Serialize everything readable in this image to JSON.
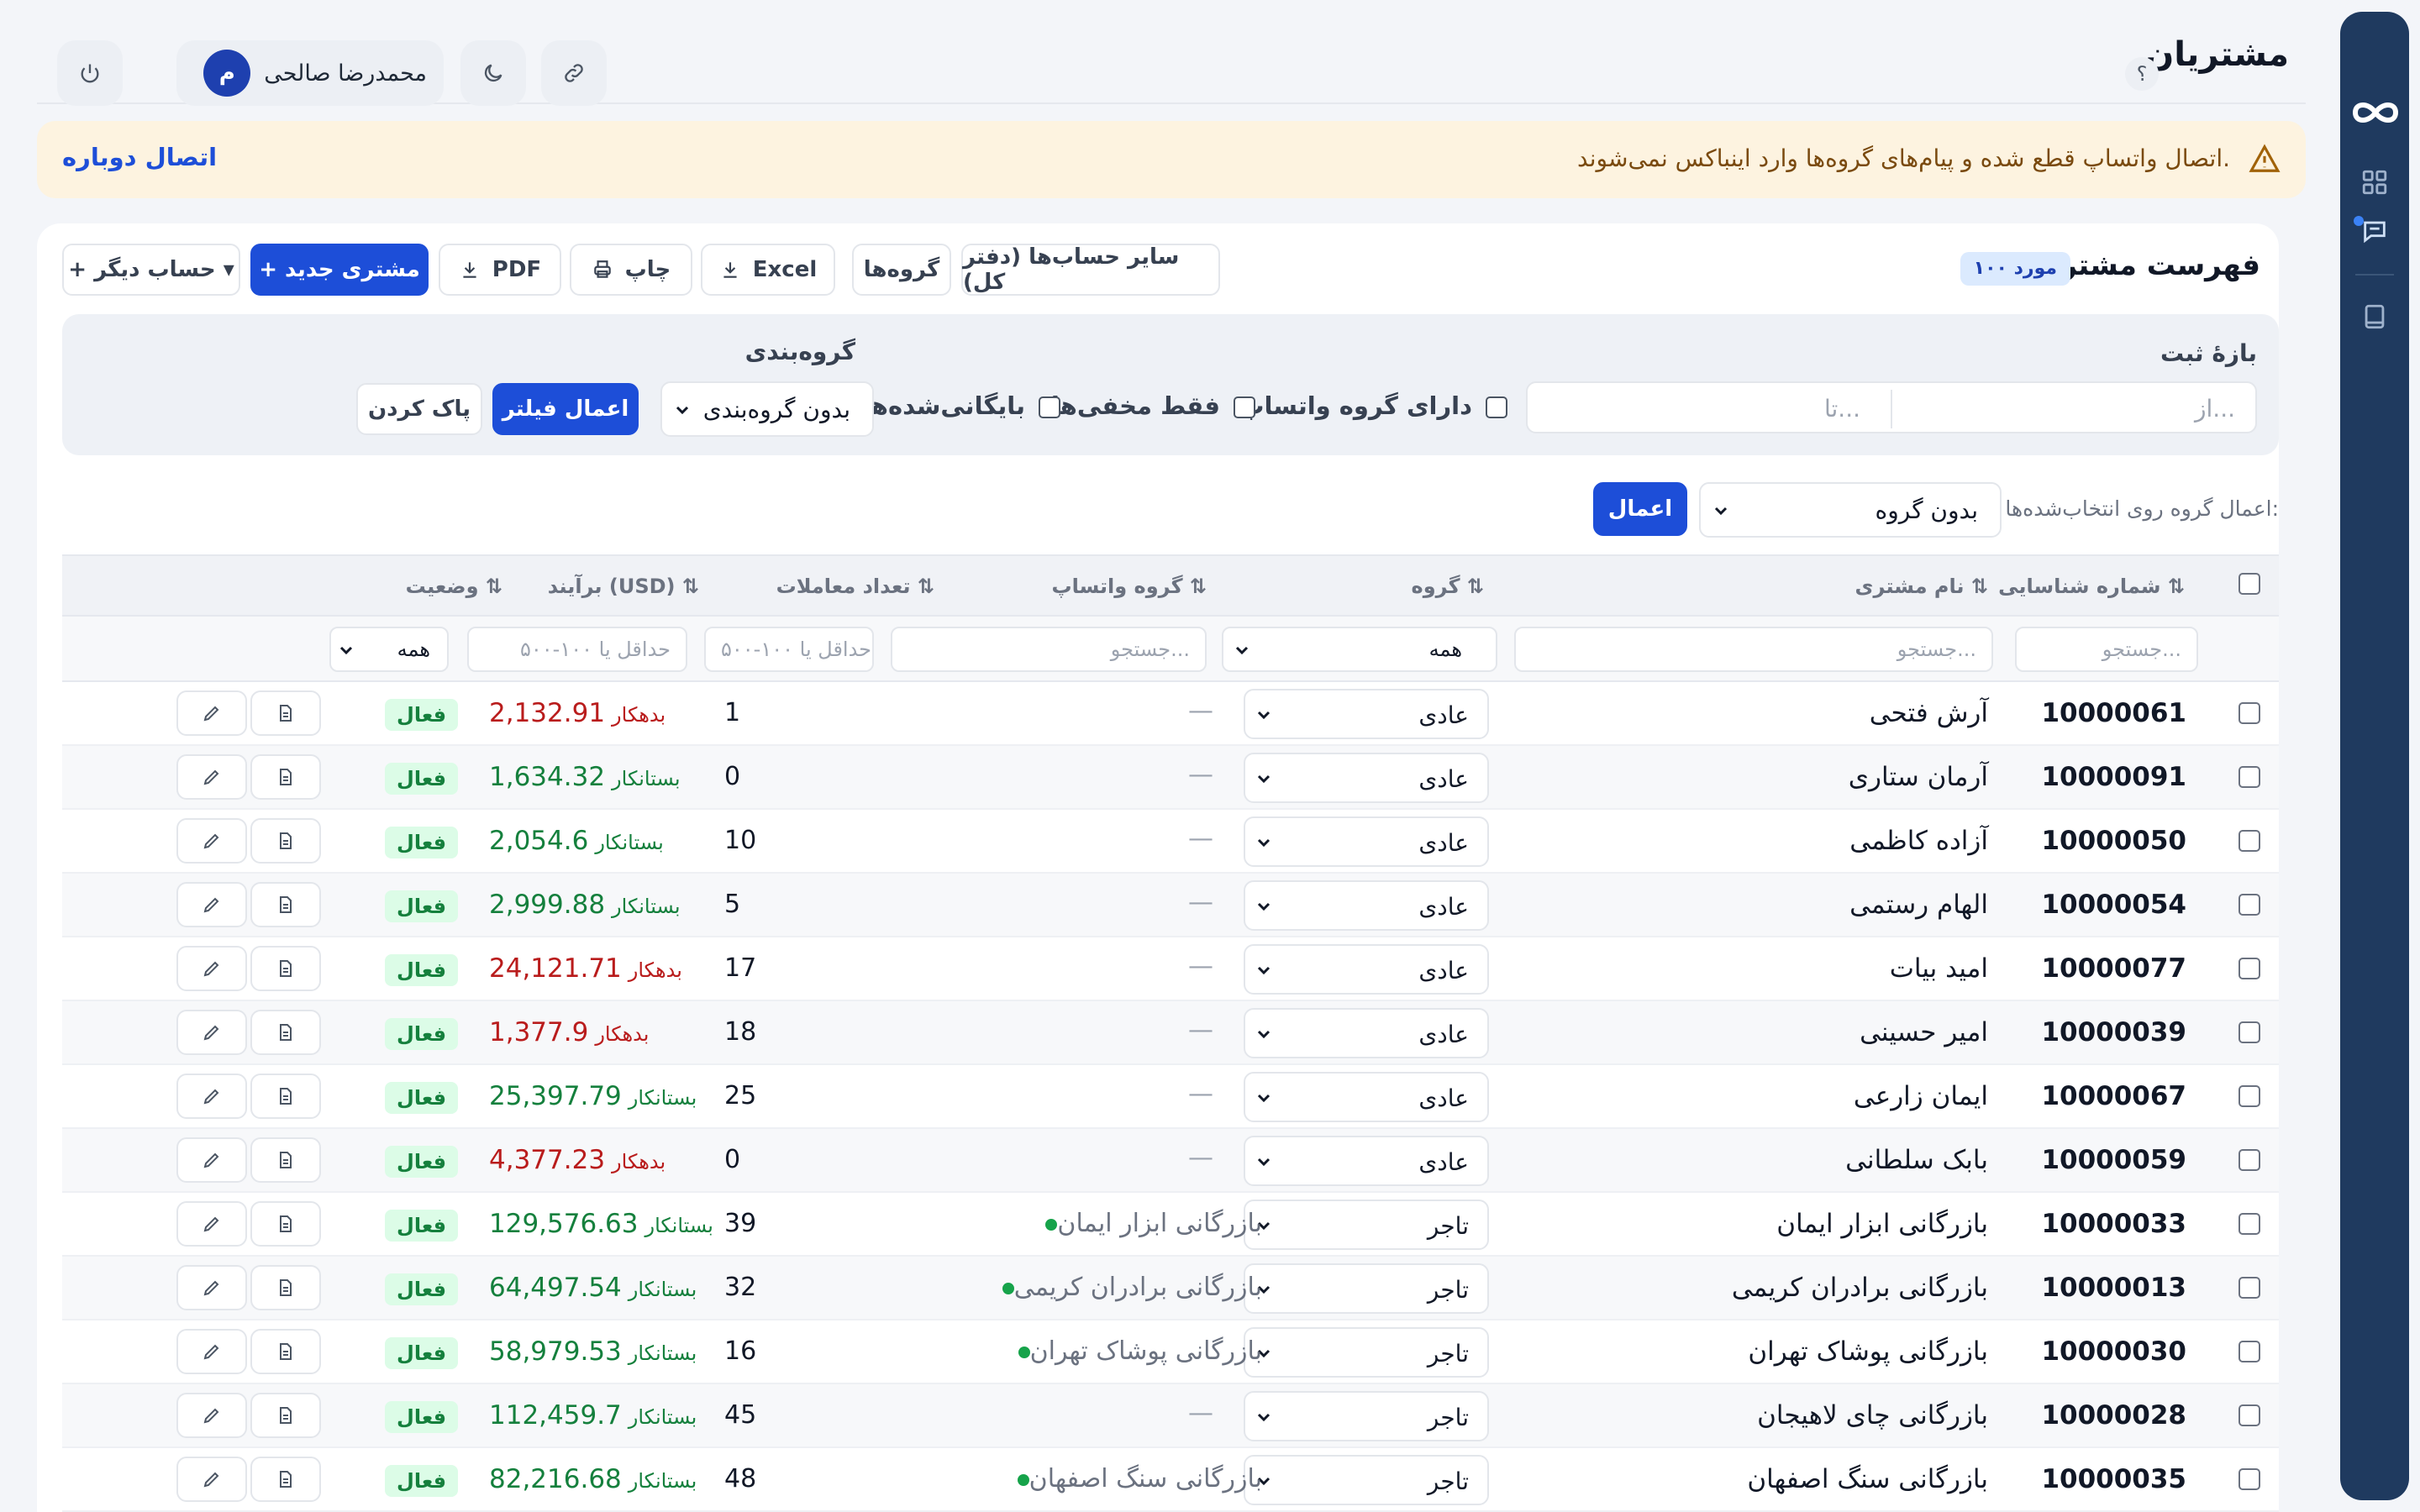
{
  "page": {
    "title": "مشتریان",
    "help": "؟"
  },
  "user": {
    "name": "محمدرضا صالحی",
    "initial": "م"
  },
  "alert": {
    "message": "اتصال واتساپ قطع شده و پیام‌های گروه‌ها وارد اینباکس نمی‌شوند.",
    "action": "اتصال دوباره"
  },
  "list": {
    "title": "فهرست مشتریان",
    "count": "۱۰۰ مورد",
    "buttons": {
      "other_accounts": "سایر حساب‌ها (دفتر کل)",
      "groups": "گروه‌ها",
      "excel": "Excel",
      "print": "چاپ",
      "pdf": "PDF",
      "new_customer": "+ مشتری جدید",
      "other_account": "+ حساب دیگر ▾"
    }
  },
  "filters": {
    "date_label": "بازهٔ ثبت",
    "from_placeholder": "از...",
    "to_placeholder": "تا...",
    "has_whatsapp": "دارای گروه واتساپ",
    "only_hidden": "فقط مخفی‌ها",
    "archived": "بایگانی‌شده‌ها",
    "grouping_label": "گروه‌بندی",
    "grouping_value": "بدون گروه‌بندی",
    "apply": "اعمال فیلتر",
    "clear": "پاک کردن"
  },
  "bulk": {
    "label": "اعمال گروه روی انتخاب‌شده‌ها:",
    "value": "بدون گروه",
    "apply": "اعمال"
  },
  "columns": {
    "id": "شماره شناسایی",
    "name": "نام مشتری",
    "group": "گروه",
    "whatsapp": "گروه واتساپ",
    "trades": "تعداد معاملات",
    "balance": "برآیند (USD)",
    "status": "وضعیت"
  },
  "column_filters": {
    "id": "جستجو...",
    "name": "جستجو...",
    "group": "همه",
    "whatsapp": "جستجو...",
    "trades": "حداقل یا ۱۰۰-۵۰۰",
    "balance": "حداقل یا ۱۰۰-۵۰۰",
    "status": "همه"
  },
  "rows": [
    {
      "id": "10000061",
      "name": "آرش فتحی",
      "group": "عادی",
      "whatsapp": "",
      "trades": "1",
      "balance_label": "بدهکار",
      "balance": "2,132.91",
      "status": "فعال"
    },
    {
      "id": "10000091",
      "name": "آرمان ستاری",
      "group": "عادی",
      "whatsapp": "",
      "trades": "0",
      "balance_label": "بستانکار",
      "balance": "1,634.32",
      "status": "فعال"
    },
    {
      "id": "10000050",
      "name": "آزاده کاظمی",
      "group": "عادی",
      "whatsapp": "",
      "trades": "10",
      "balance_label": "بستانکار",
      "balance": "2,054.6",
      "status": "فعال"
    },
    {
      "id": "10000054",
      "name": "الهام رستمی",
      "group": "عادی",
      "whatsapp": "",
      "trades": "5",
      "balance_label": "بستانکار",
      "balance": "2,999.88",
      "status": "فعال"
    },
    {
      "id": "10000077",
      "name": "امید بیات",
      "group": "عادی",
      "whatsapp": "",
      "trades": "17",
      "balance_label": "بدهکار",
      "balance": "24,121.71",
      "status": "فعال"
    },
    {
      "id": "10000039",
      "name": "امیر حسینی",
      "group": "عادی",
      "whatsapp": "",
      "trades": "18",
      "balance_label": "بدهکار",
      "balance": "1,377.9",
      "status": "فعال"
    },
    {
      "id": "10000067",
      "name": "ایمان زارعی",
      "group": "عادی",
      "whatsapp": "",
      "trades": "25",
      "balance_label": "بستانکار",
      "balance": "25,397.79",
      "status": "فعال"
    },
    {
      "id": "10000059",
      "name": "بابک سلطانی",
      "group": "عادی",
      "whatsapp": "",
      "trades": "0",
      "balance_label": "بدهکار",
      "balance": "4,377.23",
      "status": "فعال"
    },
    {
      "id": "10000033",
      "name": "بازرگانی ابزار ایمان",
      "group": "تاجر",
      "whatsapp": "بازرگانی ابزار ایمان",
      "trades": "39",
      "balance_label": "بستانکار",
      "balance": "129,576.63",
      "status": "فعال"
    },
    {
      "id": "10000013",
      "name": "بازرگانی برادران کریمی",
      "group": "تاجر",
      "whatsapp": "بازرگانی برادران کریمی",
      "trades": "32",
      "balance_label": "بستانکار",
      "balance": "64,497.54",
      "status": "فعال"
    },
    {
      "id": "10000030",
      "name": "بازرگانی پوشاک تهران",
      "group": "تاجر",
      "whatsapp": "بازرگانی پوشاک تهران",
      "trades": "16",
      "balance_label": "بستانکار",
      "balance": "58,979.53",
      "status": "فعال"
    },
    {
      "id": "10000028",
      "name": "بازرگانی چای لاهیجان",
      "group": "تاجر",
      "whatsapp": "",
      "trades": "45",
      "balance_label": "بستانکار",
      "balance": "112,459.7",
      "status": "فعال"
    },
    {
      "id": "10000035",
      "name": "بازرگانی سنگ اصفهان",
      "group": "تاجر",
      "whatsapp": "بازرگانی سنگ اصفهان",
      "trades": "48",
      "balance_label": "بستانکار",
      "balance": "82,216.68",
      "status": "فعال"
    }
  ],
  "colors": {
    "primary": "#1d4ed8",
    "rail": "#1f3a5f",
    "debit": "#b91c1c",
    "credit": "#15803d",
    "alert_bg": "#fdf3e0"
  },
  "icons": [
    "logout-icon",
    "moon-icon",
    "link-icon",
    "warning-icon",
    "download-icon",
    "printer-icon",
    "document-icon",
    "edit-icon",
    "chevron-down-icon",
    "infinity-logo",
    "grid-icon",
    "chat-icon",
    "book-icon"
  ]
}
